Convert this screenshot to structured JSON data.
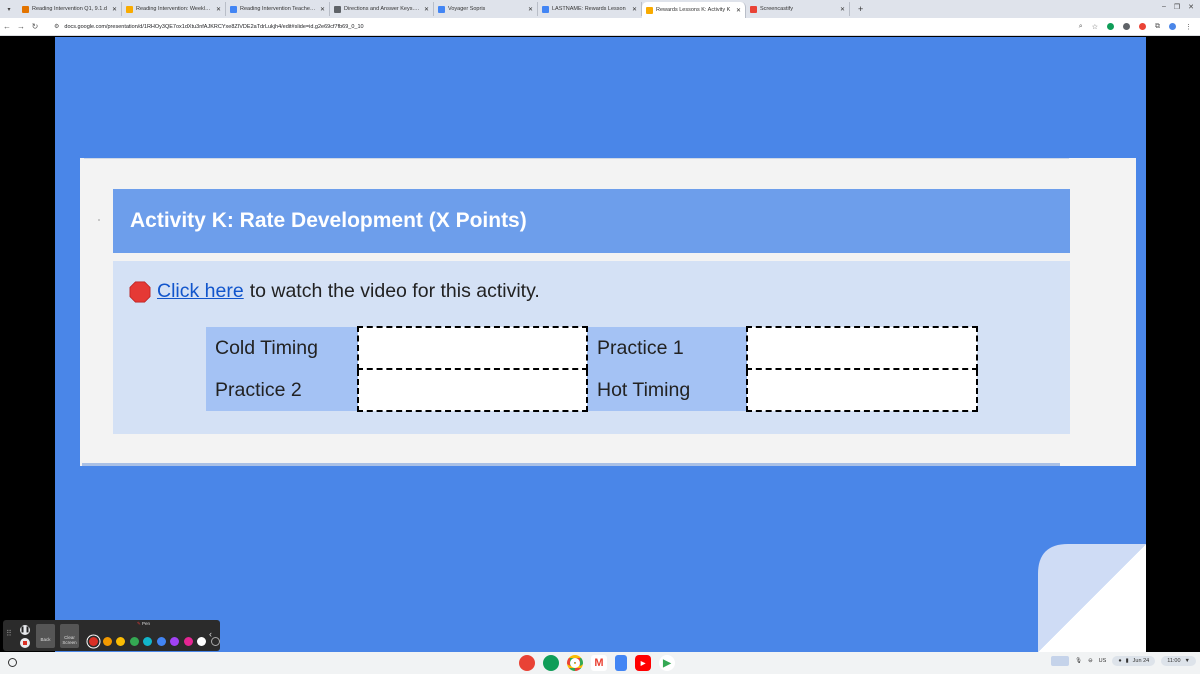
{
  "browser": {
    "tabs": [
      {
        "label": "Reading Intervention Q1, 9.1.d",
        "color": "#e37400",
        "active": false
      },
      {
        "label": "Reading Intervention: Weekly S",
        "color": "#f9ab00",
        "active": false
      },
      {
        "label": "Reading Intervention Teacher M",
        "color": "#4285f4",
        "active": false
      },
      {
        "label": "Directions and Answer Keys.pd",
        "color": "#5f6368",
        "active": false
      },
      {
        "label": "Voyager Sopris",
        "color": "#4285f4",
        "active": false
      },
      {
        "label": "LASTNAME: Rewards Lesson",
        "color": "#4285f4",
        "active": false
      },
      {
        "label": "Rewards Lessons K: Activity K",
        "color": "#f9ab00",
        "active": true
      },
      {
        "label": "Screencastify",
        "color": "#e94235",
        "active": false
      }
    ],
    "url": "docs.google.com/presentation/d/1RHOy3QE7ox1dXtu3nfAJKRCYxe8ZIVDE2aTdrLukjh4/edit#slide=id.g2e69cf7fb69_0_10"
  },
  "slide": {
    "title": "Activity K: Rate Development (X Points)",
    "instruction_link": "Click here",
    "instruction_rest": "to watch the video for this activity.",
    "table": {
      "rows": [
        {
          "left_label": "Cold Timing",
          "right_label": "Practice 1"
        },
        {
          "left_label": "Practice 2",
          "right_label": "Hot Timing"
        }
      ]
    }
  },
  "pen_toolbar": {
    "label": "Pen",
    "back_label": "Back",
    "clear_label": "Clear Screen",
    "colors": [
      "#d93025",
      "#f29900",
      "#fbbc04",
      "#34a853",
      "#12b5cb",
      "#4285f4",
      "#a142f4",
      "#e52592",
      "#ffffff",
      "#2b2b2b"
    ]
  },
  "shelf": {
    "keyboard": "US",
    "date": "Jun 24",
    "time": "11:00"
  }
}
